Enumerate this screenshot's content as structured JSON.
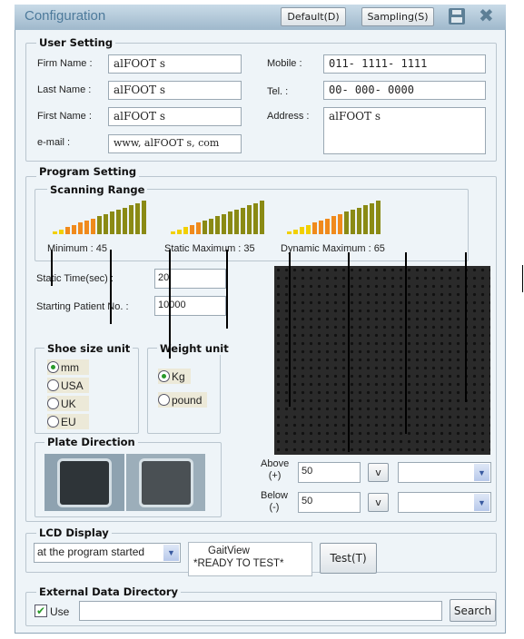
{
  "window": {
    "title": "Configuration",
    "default_button": "Default(D)",
    "sampling_button": "Sampling(S)",
    "save_icon": "floppy-disk-icon",
    "close_icon": "close-x-icon"
  },
  "user_setting": {
    "title": "User Setting",
    "firm_name": {
      "label": "Firm Name :",
      "value": "alFOOT s"
    },
    "last_name": {
      "label": "Last Name :",
      "value": "alFOOT s"
    },
    "first_name": {
      "label": "First Name :",
      "value": "alFOOT s"
    },
    "email": {
      "label": "e-mail :",
      "value": "www, alFOOT s, com"
    },
    "mobile": {
      "label": "Mobile :",
      "value": "011- 1111- 1111"
    },
    "tel": {
      "label": "Tel. :",
      "value": "00- 000- 0000"
    },
    "address": {
      "label": "Address :",
      "value": "alFOOT s"
    }
  },
  "program_setting": {
    "title": "Program Setting",
    "scanning_range": {
      "title": "Scanning Range",
      "minimum": {
        "label": "Minimum :",
        "value": "45"
      },
      "static_maximum": {
        "label": "Static Maximum :",
        "value": "35"
      },
      "dynamic_maximum": {
        "label": "Dynamic Maximum :",
        "value": "65"
      }
    },
    "static_time": {
      "label": "Static Time(sec) :",
      "value": "20"
    },
    "starting_patient": {
      "label": "Starting Patient No. :",
      "value": "10000"
    },
    "shoe_size_unit": {
      "title": "Shoe size unit",
      "options": [
        "mm",
        "USA",
        "UK",
        "EU"
      ],
      "selected": "mm"
    },
    "weight_unit": {
      "title": "Weight unit",
      "options": [
        "Kg",
        "pound"
      ],
      "selected": "Kg"
    },
    "plate_direction": {
      "title": "Plate Direction"
    },
    "above": {
      "label1": "Above",
      "label2": "(+)",
      "value": "50",
      "button": "v",
      "select": ""
    },
    "below": {
      "label1": "Below",
      "label2": "(-)",
      "value": "50",
      "button": "v",
      "select": ""
    }
  },
  "lcd_display": {
    "title": "LCD Display",
    "select": "at the program started",
    "line1": "GaitView",
    "line2": "*READY TO TEST*",
    "test_button": "Test(T)"
  },
  "external": {
    "title": "External Data Directory",
    "use_label": "Use",
    "use_checked": true,
    "path": "",
    "search_button": "Search"
  },
  "colors": {
    "title_text": "#4d7a9b",
    "bar_yellow": "#f2d000",
    "bar_orange": "#f08a1c",
    "bar_olive": "#8a8a14"
  }
}
